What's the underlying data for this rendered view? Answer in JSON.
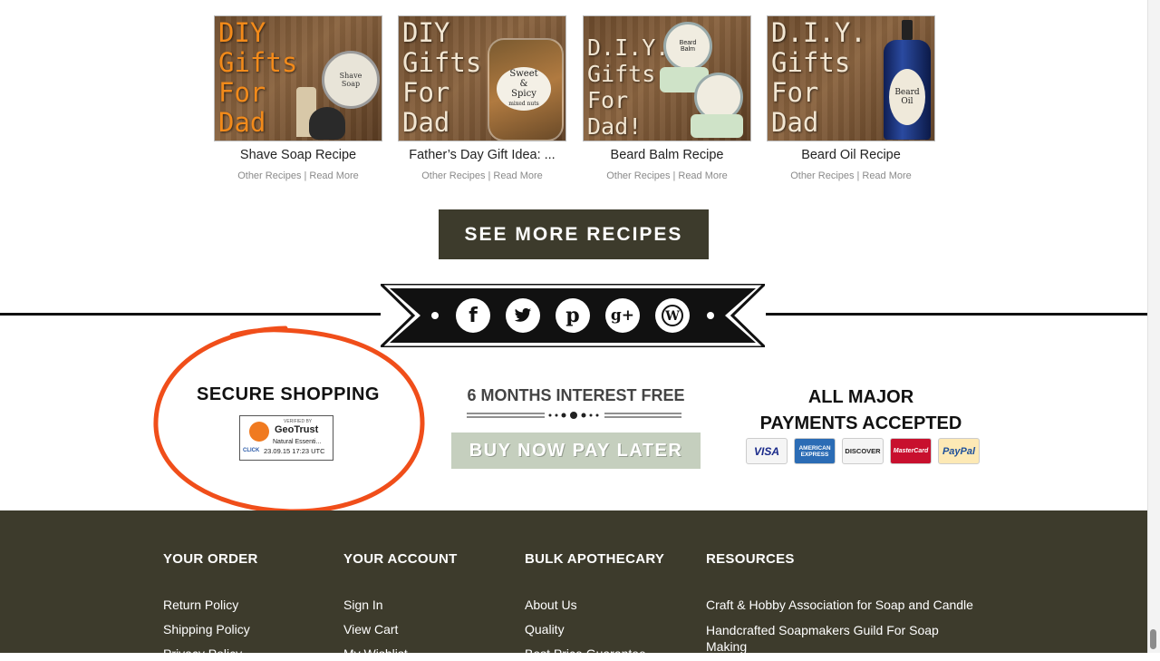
{
  "recipes": [
    {
      "image_text": "DIY\nGifts\nFor\nDad",
      "title": "Shave Soap Recipe",
      "category": "Other Recipes",
      "read_more": "Read More",
      "prop_label": "Shave\nSoap"
    },
    {
      "image_text": "DIY\nGifts\nFor\nDad",
      "title": "Father’s Day Gift Idea: ...",
      "category": "Other Recipes",
      "read_more": "Read More",
      "prop_label": "Sweet\n&\nSpicy",
      "prop_sub": "mixed nuts"
    },
    {
      "image_text": "D.I.Y.\nGifts\nFor\nDad!",
      "title": "Beard Balm Recipe",
      "category": "Other Recipes",
      "read_more": "Read More",
      "prop_label": "Beard\nBalm"
    },
    {
      "image_text": "D.I.Y.\nGifts\nFor\nDad",
      "title": "Beard Oil Recipe",
      "category": "Other Recipes",
      "read_more": "Read More",
      "prop_label": "Beard\nOil"
    }
  ],
  "see_more_label": "SEE MORE RECIPES",
  "social": [
    {
      "name": "facebook",
      "glyph": "f"
    },
    {
      "name": "twitter",
      "glyph": "t"
    },
    {
      "name": "pinterest",
      "glyph": "p"
    },
    {
      "name": "google-plus",
      "glyph": "g+"
    },
    {
      "name": "wordpress",
      "glyph": "W"
    }
  ],
  "secure": {
    "title": "SECURE SHOPPING",
    "badge_verified": "VERIFIED BY",
    "badge_brand": "GeoTrust",
    "badge_name": "Natural Essenti...",
    "badge_click": "CLICK",
    "badge_date": "23.09.15 17:23 UTC"
  },
  "financing": {
    "title": "6 MONTHS INTEREST FREE",
    "button": "BUY NOW PAY LATER"
  },
  "payments": {
    "title_line1": "ALL MAJOR",
    "title_line2": "PAYMENTS ACCEPTED",
    "cards": [
      {
        "name": "VISA",
        "color": "#1a2a8a",
        "bg": "#f5f5f5"
      },
      {
        "name": "AMERICAN EXPRESS",
        "color": "#ffffff",
        "bg": "#2b6cb5"
      },
      {
        "name": "DISCOVER",
        "color": "#222222",
        "bg": "#f5f5f5"
      },
      {
        "name": "MasterCard",
        "color": "#ffffff",
        "bg": "#c8102e"
      },
      {
        "name": "PayPal",
        "color": "#1d4f9a",
        "bg": "#fde9b5"
      }
    ]
  },
  "footer": {
    "columns": [
      {
        "heading": "YOUR ORDER",
        "links": [
          "Return Policy",
          "Shipping Policy",
          "Privacy Policy"
        ]
      },
      {
        "heading": "YOUR ACCOUNT",
        "links": [
          "Sign In",
          "View Cart",
          "My Wishlist"
        ]
      },
      {
        "heading": "BULK APOTHECARY",
        "links": [
          "About Us",
          "Quality",
          "Best Price Guarantee"
        ]
      },
      {
        "heading": "RESOURCES",
        "links": [
          "Craft & Hobby Association for Soap and Candle",
          "Handcrafted Soapmakers Guild For Soap Making"
        ]
      }
    ]
  },
  "colors": {
    "dark_olive": "#3d3b2c",
    "sage": "#c5cfbe",
    "annotation_orange": "#f04e1a"
  }
}
